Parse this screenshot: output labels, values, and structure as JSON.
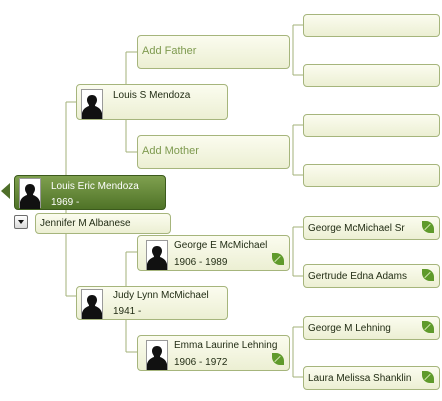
{
  "tree": {
    "root": {
      "name": "Louis Eric Mendoza",
      "dates": "1969 -"
    },
    "spouse": {
      "name": "Jennifer M Albanese"
    },
    "father": {
      "name": "Louis S Mendoza"
    },
    "father_parents": {
      "add_father": "Add Father",
      "add_mother": "Add Mother"
    },
    "mother": {
      "name": "Judy Lynn McMichael",
      "dates": "1941 -"
    },
    "maternal_grandfather": {
      "name": "George E McMichael",
      "dates": "1906 - 1989"
    },
    "maternal_grandmother": {
      "name": "Emma Laurine Lehning",
      "dates": "1906 - 1972"
    },
    "great_grandparents": [
      {
        "name": ""
      },
      {
        "name": ""
      },
      {
        "name": ""
      },
      {
        "name": ""
      },
      {
        "name": "George McMichael Sr"
      },
      {
        "name": "Gertrude Edna Adams"
      },
      {
        "name": "George M Lehning"
      },
      {
        "name": "Laura Melissa Shanklin"
      }
    ]
  },
  "icons": {
    "photo": "person-silhouette-icon",
    "hint": "leaf-hint-icon",
    "navigate": "arrow-left-icon",
    "dropdown": "chevron-down-icon"
  },
  "colors": {
    "selected_bg": "#5f7f33",
    "box_border": "#a6b57c",
    "add_text": "#7e9a4f",
    "leaf": "#5f9a2b"
  }
}
